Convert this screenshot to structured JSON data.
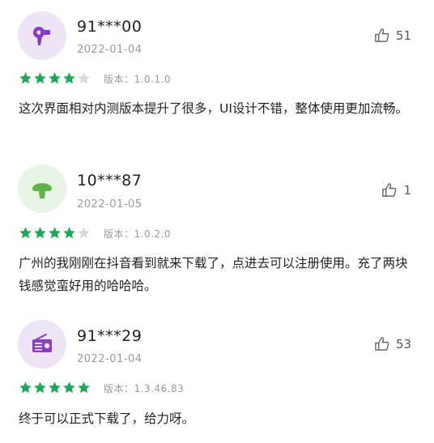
{
  "reviews": [
    {
      "username": "91***00",
      "date": "2022-01-04",
      "likes": "51",
      "rating": 4,
      "version_label": "版本：1.0.1.0",
      "comment": "这次界面相对内测版本提升了很多，UI设计不错，整体使用更加流畅。",
      "avatar_icon": "hair-dryer-icon",
      "avatar_bg": "#efe4f6",
      "avatar_color": "#8a3cc5"
    },
    {
      "username": "10***87",
      "date": "2022-01-05",
      "likes": "1",
      "rating": 4,
      "version_label": "版本：1.0.2.0",
      "comment": "广州的我刚刚在抖音看到就来下载了，点进去可以注册使用。充了两块钱感觉蛮好用的哈哈哈。",
      "avatar_icon": "mushroom-icon",
      "avatar_bg": "#e8f5e6",
      "avatar_color": "#5fb34a"
    },
    {
      "username": "91***29",
      "date": "2022-01-04",
      "likes": "53",
      "rating": 5,
      "version_label": "版本：1.3.46.83",
      "comment": "终于可以正式下载了，给力呀。",
      "avatar_icon": "radio-icon",
      "avatar_bg": "#efe4f6",
      "avatar_color": "#8a3cc5"
    }
  ],
  "colors": {
    "star_filled": "#1aaa55",
    "star_empty": "#d9d9d9"
  }
}
